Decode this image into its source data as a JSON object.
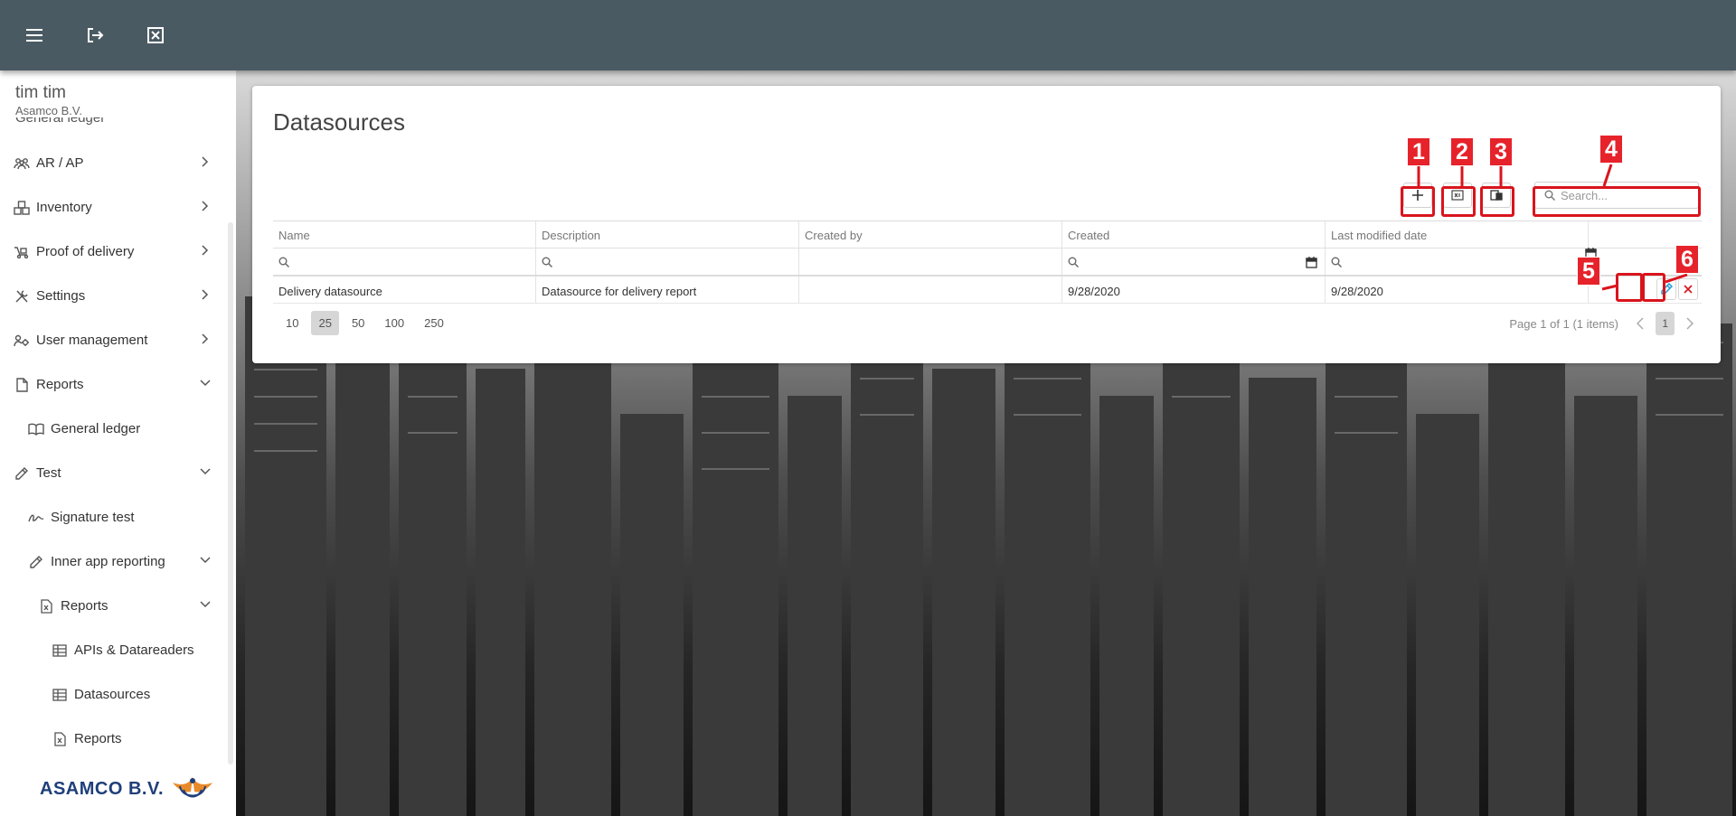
{
  "topbar": {
    "menu_icon": "hamburger-menu-icon",
    "logout_icon": "logout-icon",
    "close_icon": "close-box-icon"
  },
  "user": {
    "name": "tim tim",
    "company": "Asamco B.V."
  },
  "sidebar": {
    "clipped_label": "General ledger",
    "items": [
      {
        "label": "AR / AP",
        "icon": "users-icon"
      },
      {
        "label": "Inventory",
        "icon": "boxes-icon"
      },
      {
        "label": "Proof of delivery",
        "icon": "delivery-truck-icon"
      },
      {
        "label": "Settings",
        "icon": "tools-icon"
      },
      {
        "label": "User management",
        "icon": "users-gear-icon"
      },
      {
        "label": "Reports",
        "icon": "document-icon"
      },
      {
        "label": "General ledger",
        "icon": "book-icon"
      },
      {
        "label": "Test",
        "icon": "pencil-icon"
      },
      {
        "label": "Signature test",
        "icon": "signature-icon"
      },
      {
        "label": "Inner app reporting",
        "icon": "pencil-icon"
      },
      {
        "label": "Reports",
        "icon": "excel-file-icon"
      },
      {
        "label": "APIs & Datareaders",
        "icon": "table-icon"
      },
      {
        "label": "Datasources",
        "icon": "table-icon"
      },
      {
        "label": "Reports",
        "icon": "excel-file-icon"
      }
    ],
    "logo_text": "ASAMCO B.V."
  },
  "page": {
    "title": "Datasources"
  },
  "toolbar": {
    "add_icon": "plus-icon",
    "export_icon": "export-excel-icon",
    "columns_icon": "column-chooser-icon",
    "search_placeholder": "Search..."
  },
  "grid": {
    "columns": [
      "Name",
      "Description",
      "Created by",
      "Created",
      "Last modified date",
      ""
    ],
    "rows": [
      {
        "name": "Delivery datasource",
        "description": "Datasource for delivery report",
        "created_by": "",
        "created": "9/28/2020",
        "modified": "9/28/2020"
      }
    ]
  },
  "pager": {
    "sizes": [
      "10",
      "25",
      "50",
      "100",
      "250"
    ],
    "active_size": "25",
    "info": "Page 1 of 1 (1 items)",
    "current_page": "1"
  },
  "annotations": [
    "1",
    "2",
    "3",
    "4",
    "5",
    "6"
  ],
  "colors": {
    "topbar": "#4a5a63",
    "annotation": "#e6232a",
    "edit_icon": "#1e9bd7",
    "delete_icon": "#d9141c"
  }
}
